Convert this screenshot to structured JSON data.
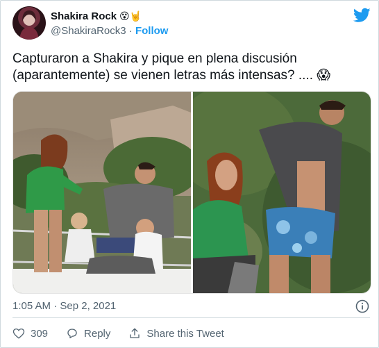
{
  "author": {
    "name": "Shakira Rock",
    "emoji": "😵🤘",
    "handle": "@ShakiraRock3",
    "separator": "·",
    "follow_label": "Follow"
  },
  "tweet": {
    "text": "Capturaron a Shakira y pique en plena discusión (aparantemente) se vienen letras más intensas? .... 😱",
    "timestamp": "1:05 AM · Sep 2, 2021"
  },
  "actions": {
    "like_count": "309",
    "reply_label": "Reply",
    "share_label": "Share this Tweet"
  },
  "colors": {
    "accent": "#1d9bf0",
    "muted": "#536471",
    "like_red": "#f91880"
  }
}
